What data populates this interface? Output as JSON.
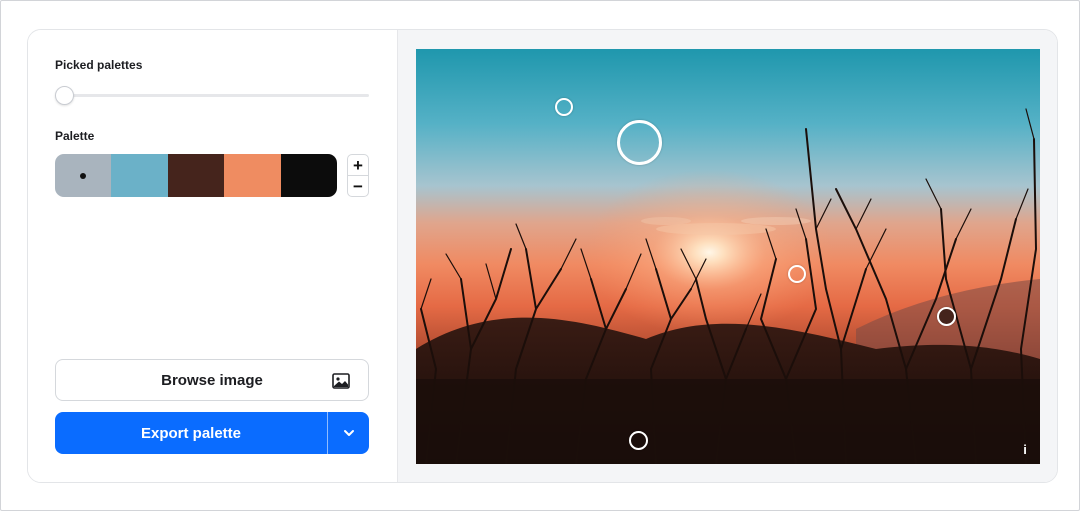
{
  "left_panel": {
    "picked_palettes_label": "Picked palettes",
    "slider_value": 0,
    "palette_label": "Palette",
    "swatches": [
      {
        "color": "#a9b4be",
        "selected": true
      },
      {
        "color": "#6bb1c8",
        "selected": false
      },
      {
        "color": "#45241c",
        "selected": false
      },
      {
        "color": "#ef8c61",
        "selected": false
      },
      {
        "color": "#0c0c0c",
        "selected": false
      }
    ],
    "stepper": {
      "plus": "+",
      "minus": "−"
    },
    "browse_label": "Browse image",
    "browse_icon": "image-icon",
    "export_label": "Export palette",
    "export_caret_icon": "chevron-down-icon"
  },
  "image_panel": {
    "info_label": "i",
    "pickers": [
      {
        "color": "#a9b4be",
        "active": true
      },
      {
        "color": "#6bb1c8",
        "active": false
      },
      {
        "color": "#45241c",
        "active": false
      },
      {
        "color": "#ef8c61",
        "active": false
      },
      {
        "color": "#0c0c0c",
        "active": false
      }
    ]
  },
  "colors": {
    "accent": "#0a6cff"
  }
}
